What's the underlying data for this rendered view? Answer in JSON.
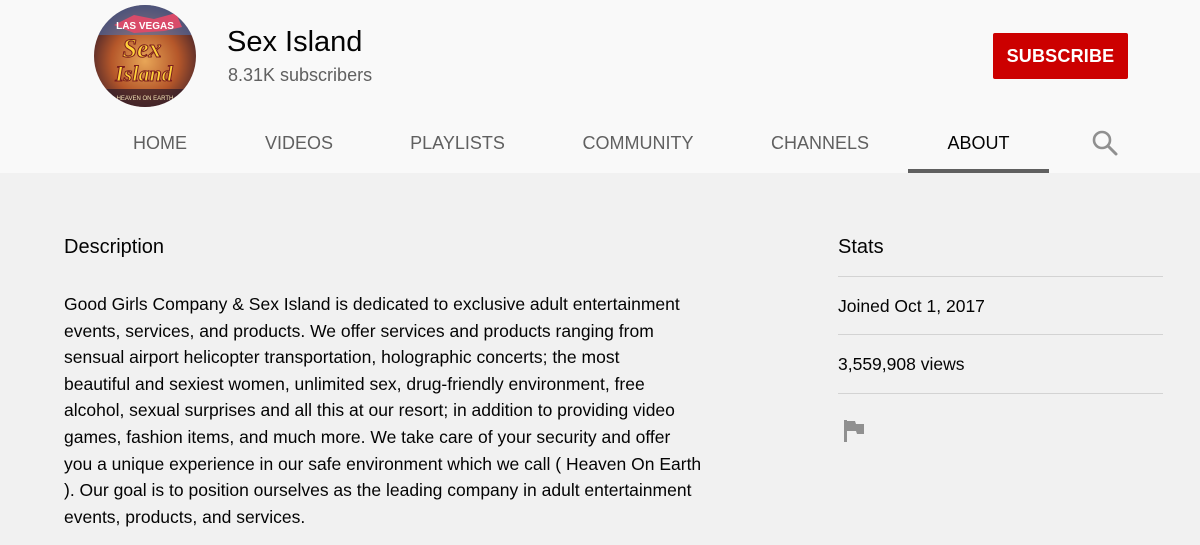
{
  "channel": {
    "name": "Sex Island",
    "subscribers": "8.31K subscribers",
    "avatar_text": [
      "LAS VEGAS",
      "Sex",
      "Island",
      "HEAVEN ON EARTH"
    ]
  },
  "header": {
    "subscribe_label": "SUBSCRIBE"
  },
  "tabs": [
    {
      "label": "HOME"
    },
    {
      "label": "VIDEOS"
    },
    {
      "label": "PLAYLISTS"
    },
    {
      "label": "COMMUNITY"
    },
    {
      "label": "CHANNELS"
    },
    {
      "label": "ABOUT",
      "active": true
    }
  ],
  "icons": {
    "search": "search-icon",
    "flag": "flag-icon"
  },
  "about": {
    "description_title": "Description",
    "description_lines": [
      "Good Girls Company & Sex Island is dedicated to exclusive adult entertainment",
      "events, services, and products. We offer services and products ranging from",
      "sensual airport helicopter transportation, holographic concerts; the most",
      "beautiful and sexiest women, unlimited sex, drug-friendly environment, free",
      "alcohol, sexual surprises and all this at our resort; in addition to providing video",
      "games, fashion items, and much more. We take care of your security and offer",
      "you a unique experience in our safe environment which we call ( Heaven On Earth",
      "). Our goal is to position ourselves as the leading company in adult entertainment",
      "events, products, and services."
    ],
    "stats_title": "Stats",
    "joined": "Joined Oct 1, 2017",
    "views": "3,559,908 views"
  },
  "colors": {
    "subscribe_bg": "#cc0000",
    "header_bg": "#f9f9f9",
    "page_bg": "#f1f1f1",
    "tab_indicator": "#606060"
  }
}
